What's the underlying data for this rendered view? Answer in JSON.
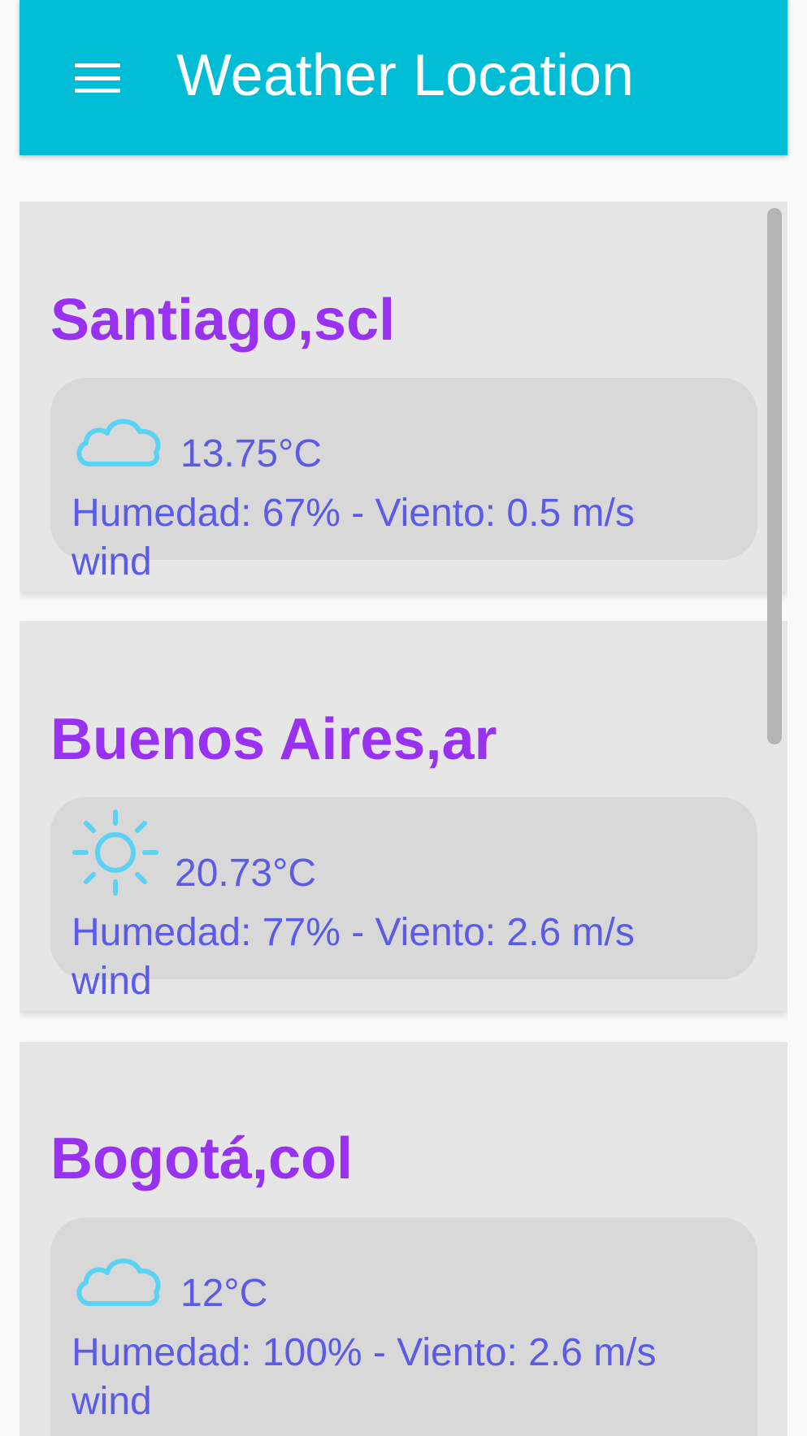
{
  "toolbar": {
    "title": "Weather Location",
    "menu_icon": "hamburger-menu-icon",
    "background": "#00bcd4"
  },
  "locations": [
    {
      "name": "Santiago,scl",
      "icon": "cloud-icon",
      "temperature": "13.75°C",
      "details": "Humedad: 67% - Viento: 0.5 m/s wind"
    },
    {
      "name": "Buenos Aires,ar",
      "icon": "sun-icon",
      "temperature": "20.73°C",
      "details": "Humedad: 77% - Viento: 2.6 m/s wind"
    },
    {
      "name": "Bogotá,col",
      "icon": "cloud-icon",
      "temperature": "12°C",
      "details": "Humedad: 100% - Viento: 2.6 m/s wind"
    }
  ],
  "colors": {
    "city_name": "#9932f0",
    "weather_text": "#5b5ce6",
    "icon": "#5ad2f4",
    "card": "#e6e6e6",
    "info_box": "#d8d8d8"
  }
}
